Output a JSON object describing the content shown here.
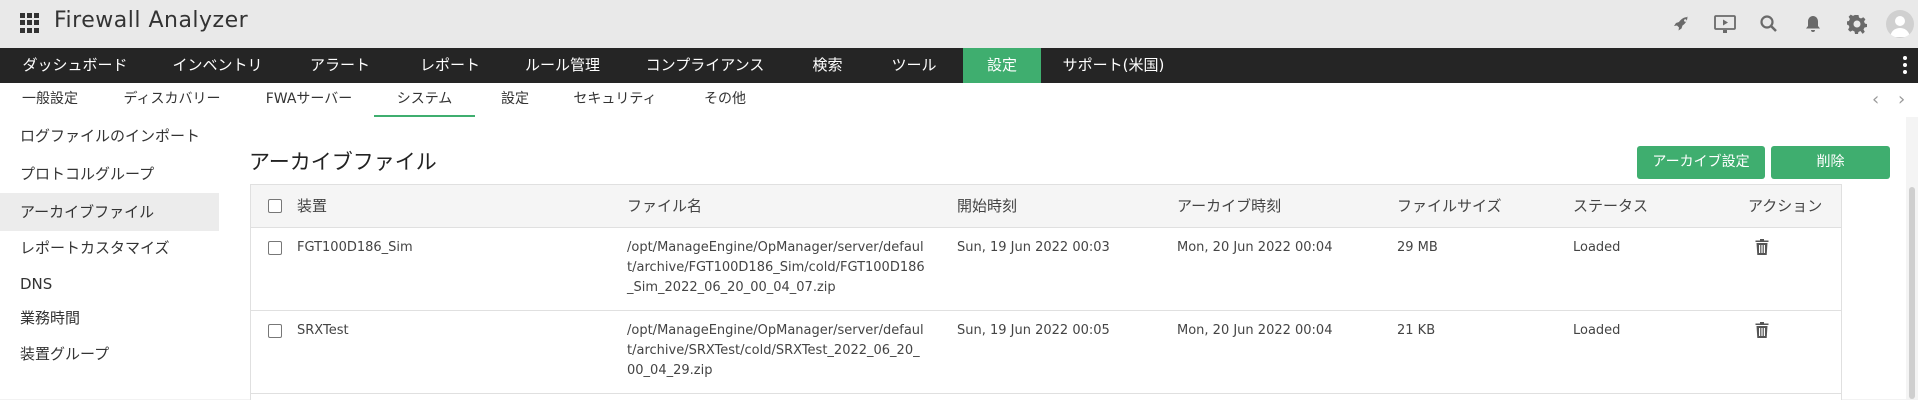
{
  "header": {
    "app_title": "Firewall Analyzer",
    "icons": [
      "apps-grid-icon",
      "rocket-icon",
      "presentation-icon",
      "search-icon",
      "bell-icon",
      "gear-icon",
      "user-avatar-icon"
    ]
  },
  "main_nav": {
    "items": [
      "ダッシュボード",
      "インベントリ",
      "アラート",
      "レポート",
      "ルール管理",
      "コンプライアンス",
      "検索",
      "ツール",
      "設定",
      "サポート(米国)"
    ],
    "active": "設定"
  },
  "sub_nav": {
    "items": [
      "一般設定",
      "ディスカバリー",
      "FWAサーバー",
      "システム",
      "設定",
      "セキュリティ",
      "その他"
    ],
    "active": "システム"
  },
  "sidebar": {
    "items": [
      "ログファイルのインポート",
      "プロトコルグループ",
      "アーカイブファイル",
      "レポートカスタマイズ",
      "DNS",
      "業務時間",
      "装置グループ"
    ],
    "active": "アーカイブファイル"
  },
  "main": {
    "title": "アーカイブファイル",
    "archive_settings_label": "アーカイブ設定",
    "delete_label": "削除"
  },
  "table": {
    "columns": [
      "装置",
      "ファイル名",
      "開始時刻",
      "アーカイブ時刻",
      "ファイルサイズ",
      "ステータス",
      "アクション"
    ],
    "rows": [
      {
        "device": "FGT100D186_Sim",
        "file": "/opt/ManageEngine/OpManager/server/default/archive/FGT100D186_Sim/cold/FGT100D186_Sim_2022_06_20_00_04_07.zip",
        "start": "Sun, 19 Jun 2022 00:03",
        "archived": "Mon, 20 Jun 2022 00:04",
        "size": "29 MB",
        "status": "Loaded"
      },
      {
        "device": "SRXTest",
        "file": "/opt/ManageEngine/OpManager/server/default/archive/SRXTest/cold/SRXTest_2022_06_20_00_04_29.zip",
        "start": "Sun, 19 Jun 2022 00:05",
        "archived": "Mon, 20 Jun 2022 00:04",
        "size": "21 KB",
        "status": "Loaded"
      }
    ]
  },
  "colors": {
    "accent": "#3fae6f",
    "nav_bg": "#252525",
    "header_bg": "#e9e9e9"
  }
}
